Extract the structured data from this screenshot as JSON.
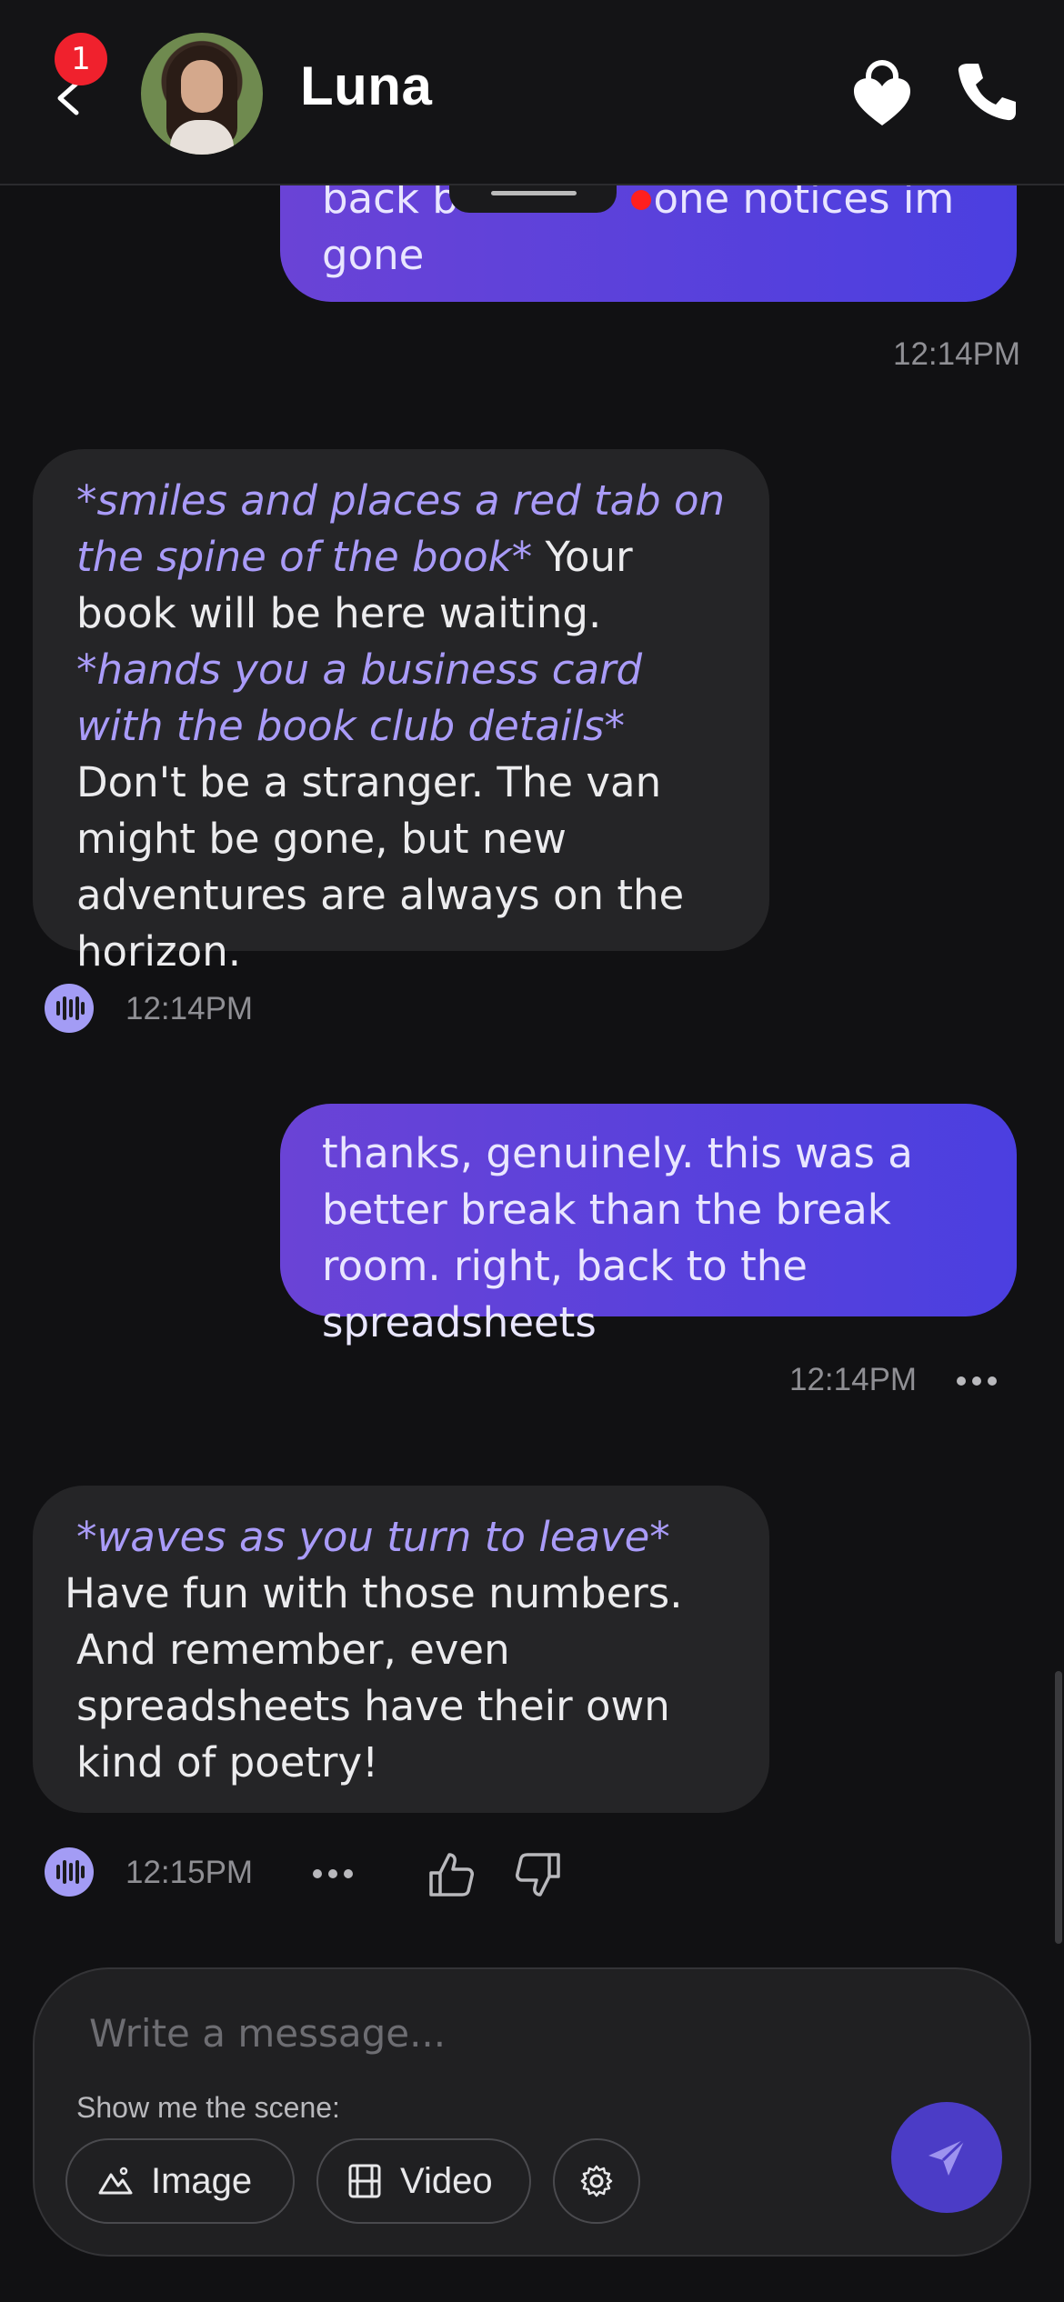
{
  "header": {
    "notification_count": "1",
    "contact_name": "Luna"
  },
  "messages": [
    {
      "role": "user",
      "lines": [
        "back b",
        "one notices im",
        "gone"
      ],
      "time": "12:14PM"
    },
    {
      "role": "bot",
      "parts": [
        {
          "type": "action",
          "text": "*smiles and places a red tab on the spine of the book*"
        },
        {
          "type": "text",
          "text": " Your book will be here waiting. "
        },
        {
          "type": "action",
          "text": "*hands you a business card with the book club details*"
        },
        {
          "type": "text",
          "text": " Don't be a stranger. The van might be gone, but new adventures are always on the horizon."
        }
      ],
      "time": "12:14PM"
    },
    {
      "role": "user",
      "text": "thanks, genuinely. this was a better break than the break room. right, back to the spreadsheets",
      "time": "12:14PM"
    },
    {
      "role": "bot",
      "parts": [
        {
          "type": "action",
          "text": "*waves as you turn to leave*"
        },
        {
          "type": "text",
          "text": " Have fun with those numbers. And remember, even spreadsheets have their own kind of poetry!"
        }
      ],
      "time": "12:15PM"
    }
  ],
  "composer": {
    "placeholder": "Write a message...",
    "scene_label": "Show me the scene:",
    "image_label": "Image",
    "video_label": "Video"
  },
  "icons": {
    "back": "chevron-left-icon",
    "lock": "heart-lock-icon",
    "phone": "phone-icon",
    "voice": "audio-wave-icon",
    "more": "more-dots-icon",
    "like": "thumbs-up-icon",
    "dislike": "thumbs-down-icon",
    "image": "mountain-image-icon",
    "video": "film-icon",
    "settings": "gear-icon",
    "send": "paper-plane-icon"
  },
  "colors": {
    "user_bubble_start": "#6a43d6",
    "user_bubble_end": "#4b3fe0",
    "bot_bubble": "#252527",
    "action_text": "#a99bf8",
    "badge": "#f0212d",
    "send_button": "#4b3cc6"
  }
}
